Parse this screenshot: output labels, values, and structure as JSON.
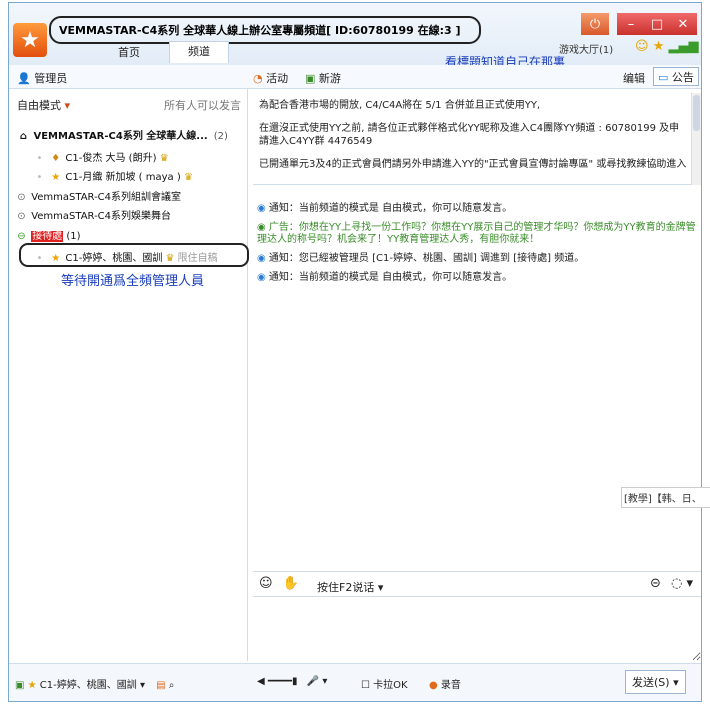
{
  "title": {
    "text": "VEMMASTAR-C4系列 全球華人線上辦公室專屬頻道[ ID:60780199 在線:3 ]",
    "logo_icon": "star-icon"
  },
  "tabs": [
    "首页",
    "频道"
  ],
  "game_hall": "游戏大厅(1)",
  "annotation_location": "看標題知道自己在那裏",
  "toolbar": {
    "admin": "管理员",
    "activity": "活动",
    "new_game": "新游",
    "edit": "编辑",
    "notice": "公告"
  },
  "left_panel": {
    "mode": "自由模式",
    "all_speak": "所有人可以发言",
    "root_channel": "VEMMASTAR-C4系列 全球華人線...",
    "root_count": "(2)",
    "user1": "C1-俊杰 大马 (朗升)",
    "user2": "C1-月織 新加坡 ( maya )",
    "channel1": "VemmaSTAR-C4系列組訓會議室",
    "channel2": "VemmaSTAR-C4系列娛樂舞台",
    "reception_label": "接待處",
    "reception_count": "(1)",
    "user3": "C1-婷婷、桃園、國訓",
    "user3_restrict": "限住自稿",
    "annotation_wait": "等待開通爲全頻管理人員"
  },
  "board": {
    "p1": "為配合香港市場的開放, C4/C4A將在 5/1 合併並且正式使用YY,",
    "p2": "在還沒正式使用YY之前, 請各位正式夥伴格式化YY昵称及進入C4團隊YY頻道 : 60780199 及申請進入C4YY群 4476549",
    "p3": "已開通單元3及4的正式會員們請另外申請進入YY的\"正式會員宣傳討論專區\" 或尋找教練協助進入"
  },
  "chat": [
    {
      "type": "notice",
      "text": "通知：当前频道的模式是 自由模式，你可以随意发言。"
    },
    {
      "type": "ad",
      "text": "广告：你想在YY上寻找一份工作吗？你想在YY展示自己的管理才华吗？你想成为YY教育的金牌管理达人的称号吗？机会来了！YY教育管理达人秀，有胆你就来！"
    },
    {
      "type": "notice",
      "text": "通知：您已經被管理员 [C1-婷婷、桃園、國訓] 调進到 [接待處] 频道。"
    },
    {
      "type": "notice",
      "text": "通知：当前频道的模式是 自由模式，你可以随意发言。"
    }
  ],
  "floating_tag": "[教學]【韩、日、",
  "input_bar": {
    "f2_label": "按住F2说话"
  },
  "bottom": {
    "current_user": "C1-婷婷、桃園、國訓",
    "karaoke": "卡拉OK",
    "record": "录音",
    "send": "发送(S)"
  },
  "colors": {
    "title_bg": "#e2ecf7",
    "close_button": "#c9302c",
    "annotation": "#1a3dbb",
    "reception_highlight": "#e02020",
    "ad_text": "#3a8c2a"
  }
}
